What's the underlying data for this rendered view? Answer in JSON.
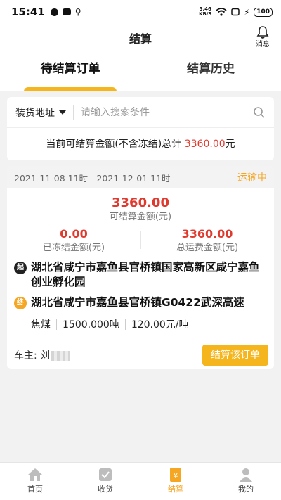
{
  "statusbar": {
    "time": "15:41",
    "speed_top": "3.46",
    "speed_bottom": "KB/S",
    "battery": "100"
  },
  "header": {
    "title": "结算",
    "message_label": "消息"
  },
  "tabs": [
    {
      "label": "待结算订单",
      "active": true
    },
    {
      "label": "结算历史",
      "active": false
    }
  ],
  "search": {
    "filter_label": "装货地址",
    "placeholder": "请输入搜索条件"
  },
  "summary": {
    "prefix": "当前可结算金额(不含冻结)总计",
    "amount": "3360.00",
    "suffix": "元"
  },
  "order": {
    "time_range": "2021-11-08 11时 - 2021-12-01 11时",
    "status": "运输中",
    "settle_amount": "3360.00",
    "settle_label": "可结算金额(元)",
    "frozen_amount": "0.00",
    "frozen_label": "已冻结金额(元)",
    "total_freight": "3360.00",
    "total_freight_label": "总运费金额(元)",
    "start_icon": "起",
    "start_address": "湖北省咸宁市嘉鱼县官桥镇国家高新区咸宁嘉鱼创业孵化园",
    "end_icon": "终",
    "end_address": "湖北省咸宁市嘉鱼县官桥镇G0422武深高速",
    "goods": "焦煤",
    "weight": "1500.000吨",
    "unit_price": "120.00元/吨",
    "driver_label": "车主: 刘",
    "settle_button": "结算该订单"
  },
  "nav": [
    {
      "label": "首页",
      "icon": "home-icon"
    },
    {
      "label": "收货",
      "icon": "receive-icon"
    },
    {
      "label": "结算",
      "icon": "settle-icon",
      "active": true
    },
    {
      "label": "我的",
      "icon": "profile-icon"
    }
  ],
  "colors": {
    "accent": "#f5b51d",
    "amount_red": "#e03a2f",
    "status_orange": "#f5a623"
  }
}
